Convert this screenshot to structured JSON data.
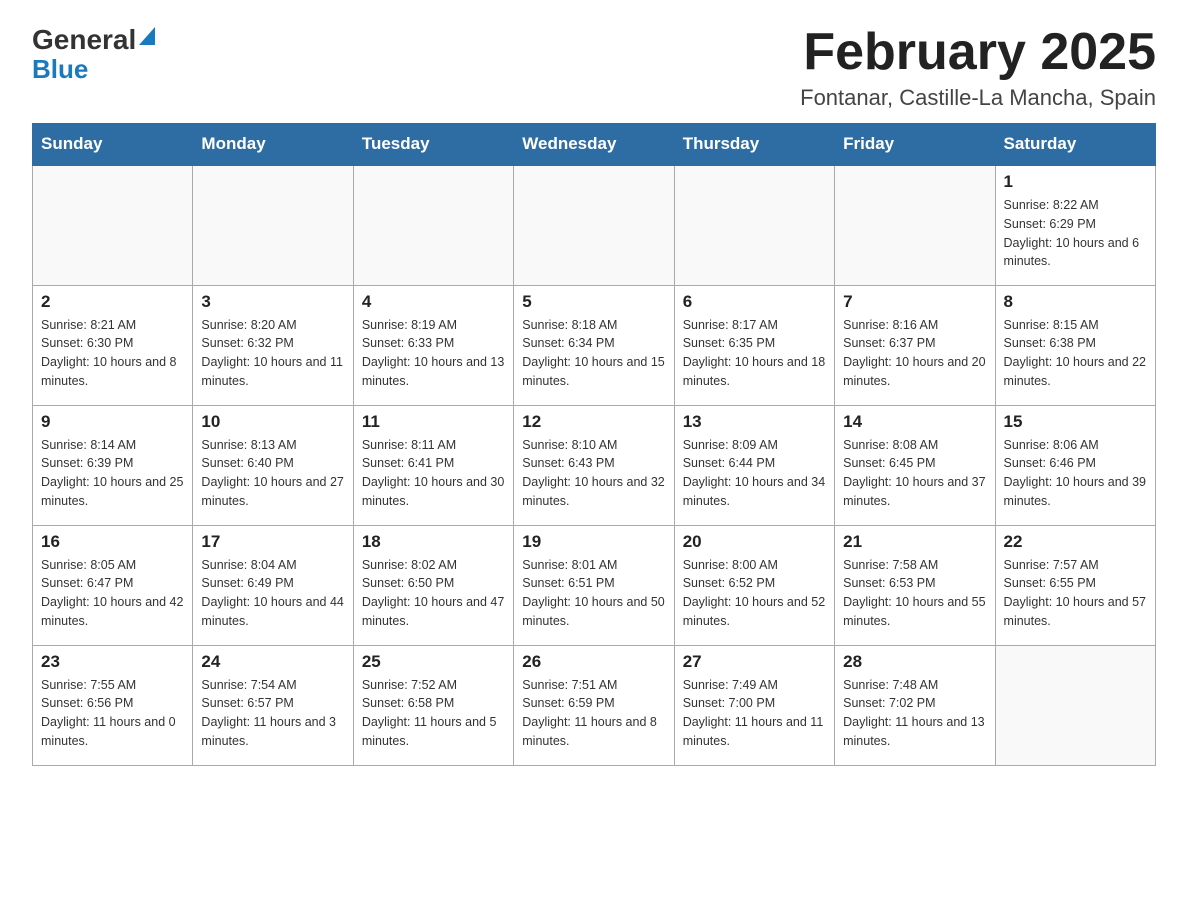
{
  "header": {
    "logo_general": "General",
    "logo_blue": "Blue",
    "title": "February 2025",
    "subtitle": "Fontanar, Castille-La Mancha, Spain"
  },
  "days_of_week": [
    "Sunday",
    "Monday",
    "Tuesday",
    "Wednesday",
    "Thursday",
    "Friday",
    "Saturday"
  ],
  "weeks": [
    {
      "days": [
        {
          "number": "",
          "info": "",
          "empty": true
        },
        {
          "number": "",
          "info": "",
          "empty": true
        },
        {
          "number": "",
          "info": "",
          "empty": true
        },
        {
          "number": "",
          "info": "",
          "empty": true
        },
        {
          "number": "",
          "info": "",
          "empty": true
        },
        {
          "number": "",
          "info": "",
          "empty": true
        },
        {
          "number": "1",
          "info": "Sunrise: 8:22 AM\nSunset: 6:29 PM\nDaylight: 10 hours and 6 minutes.",
          "empty": false
        }
      ]
    },
    {
      "days": [
        {
          "number": "2",
          "info": "Sunrise: 8:21 AM\nSunset: 6:30 PM\nDaylight: 10 hours and 8 minutes.",
          "empty": false
        },
        {
          "number": "3",
          "info": "Sunrise: 8:20 AM\nSunset: 6:32 PM\nDaylight: 10 hours and 11 minutes.",
          "empty": false
        },
        {
          "number": "4",
          "info": "Sunrise: 8:19 AM\nSunset: 6:33 PM\nDaylight: 10 hours and 13 minutes.",
          "empty": false
        },
        {
          "number": "5",
          "info": "Sunrise: 8:18 AM\nSunset: 6:34 PM\nDaylight: 10 hours and 15 minutes.",
          "empty": false
        },
        {
          "number": "6",
          "info": "Sunrise: 8:17 AM\nSunset: 6:35 PM\nDaylight: 10 hours and 18 minutes.",
          "empty": false
        },
        {
          "number": "7",
          "info": "Sunrise: 8:16 AM\nSunset: 6:37 PM\nDaylight: 10 hours and 20 minutes.",
          "empty": false
        },
        {
          "number": "8",
          "info": "Sunrise: 8:15 AM\nSunset: 6:38 PM\nDaylight: 10 hours and 22 minutes.",
          "empty": false
        }
      ]
    },
    {
      "days": [
        {
          "number": "9",
          "info": "Sunrise: 8:14 AM\nSunset: 6:39 PM\nDaylight: 10 hours and 25 minutes.",
          "empty": false
        },
        {
          "number": "10",
          "info": "Sunrise: 8:13 AM\nSunset: 6:40 PM\nDaylight: 10 hours and 27 minutes.",
          "empty": false
        },
        {
          "number": "11",
          "info": "Sunrise: 8:11 AM\nSunset: 6:41 PM\nDaylight: 10 hours and 30 minutes.",
          "empty": false
        },
        {
          "number": "12",
          "info": "Sunrise: 8:10 AM\nSunset: 6:43 PM\nDaylight: 10 hours and 32 minutes.",
          "empty": false
        },
        {
          "number": "13",
          "info": "Sunrise: 8:09 AM\nSunset: 6:44 PM\nDaylight: 10 hours and 34 minutes.",
          "empty": false
        },
        {
          "number": "14",
          "info": "Sunrise: 8:08 AM\nSunset: 6:45 PM\nDaylight: 10 hours and 37 minutes.",
          "empty": false
        },
        {
          "number": "15",
          "info": "Sunrise: 8:06 AM\nSunset: 6:46 PM\nDaylight: 10 hours and 39 minutes.",
          "empty": false
        }
      ]
    },
    {
      "days": [
        {
          "number": "16",
          "info": "Sunrise: 8:05 AM\nSunset: 6:47 PM\nDaylight: 10 hours and 42 minutes.",
          "empty": false
        },
        {
          "number": "17",
          "info": "Sunrise: 8:04 AM\nSunset: 6:49 PM\nDaylight: 10 hours and 44 minutes.",
          "empty": false
        },
        {
          "number": "18",
          "info": "Sunrise: 8:02 AM\nSunset: 6:50 PM\nDaylight: 10 hours and 47 minutes.",
          "empty": false
        },
        {
          "number": "19",
          "info": "Sunrise: 8:01 AM\nSunset: 6:51 PM\nDaylight: 10 hours and 50 minutes.",
          "empty": false
        },
        {
          "number": "20",
          "info": "Sunrise: 8:00 AM\nSunset: 6:52 PM\nDaylight: 10 hours and 52 minutes.",
          "empty": false
        },
        {
          "number": "21",
          "info": "Sunrise: 7:58 AM\nSunset: 6:53 PM\nDaylight: 10 hours and 55 minutes.",
          "empty": false
        },
        {
          "number": "22",
          "info": "Sunrise: 7:57 AM\nSunset: 6:55 PM\nDaylight: 10 hours and 57 minutes.",
          "empty": false
        }
      ]
    },
    {
      "days": [
        {
          "number": "23",
          "info": "Sunrise: 7:55 AM\nSunset: 6:56 PM\nDaylight: 11 hours and 0 minutes.",
          "empty": false
        },
        {
          "number": "24",
          "info": "Sunrise: 7:54 AM\nSunset: 6:57 PM\nDaylight: 11 hours and 3 minutes.",
          "empty": false
        },
        {
          "number": "25",
          "info": "Sunrise: 7:52 AM\nSunset: 6:58 PM\nDaylight: 11 hours and 5 minutes.",
          "empty": false
        },
        {
          "number": "26",
          "info": "Sunrise: 7:51 AM\nSunset: 6:59 PM\nDaylight: 11 hours and 8 minutes.",
          "empty": false
        },
        {
          "number": "27",
          "info": "Sunrise: 7:49 AM\nSunset: 7:00 PM\nDaylight: 11 hours and 11 minutes.",
          "empty": false
        },
        {
          "number": "28",
          "info": "Sunrise: 7:48 AM\nSunset: 7:02 PM\nDaylight: 11 hours and 13 minutes.",
          "empty": false
        },
        {
          "number": "",
          "info": "",
          "empty": true
        }
      ]
    }
  ]
}
